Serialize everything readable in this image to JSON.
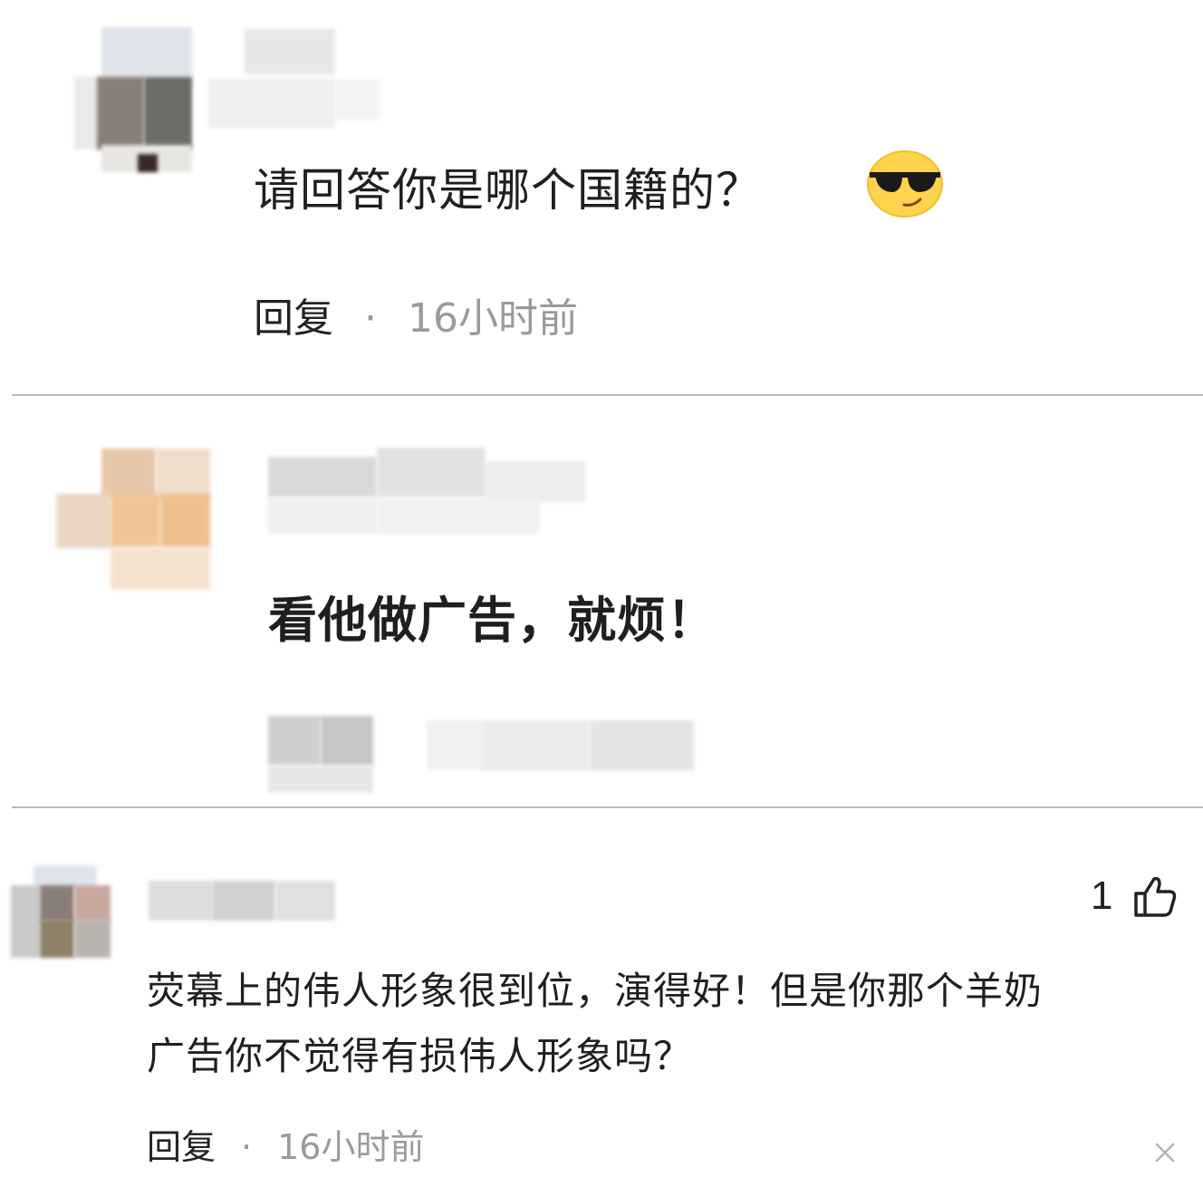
{
  "comments": [
    {
      "text": "请回答你是哪个国籍的？",
      "emoji_icon": "sunglasses-face-icon",
      "reply_label": "回复",
      "separator": "·",
      "time": "16小时前"
    },
    {
      "text": "看他做广告，就烦！"
    },
    {
      "text_line1": "荧幕上的伟人形象很到位，演得好！但是你那个羊奶",
      "text_line2": "广告你不觉得有损伟人形象吗？",
      "like_count": "1",
      "like_icon": "thumbs-up-icon",
      "reply_label": "回复",
      "separator": "·",
      "time": "16小时前",
      "close_icon": "close-icon"
    }
  ],
  "colors": {
    "text": "#1f1f1f",
    "muted": "#9a9a9a",
    "divider": "#bcbcbc",
    "background": "#ffffff"
  }
}
